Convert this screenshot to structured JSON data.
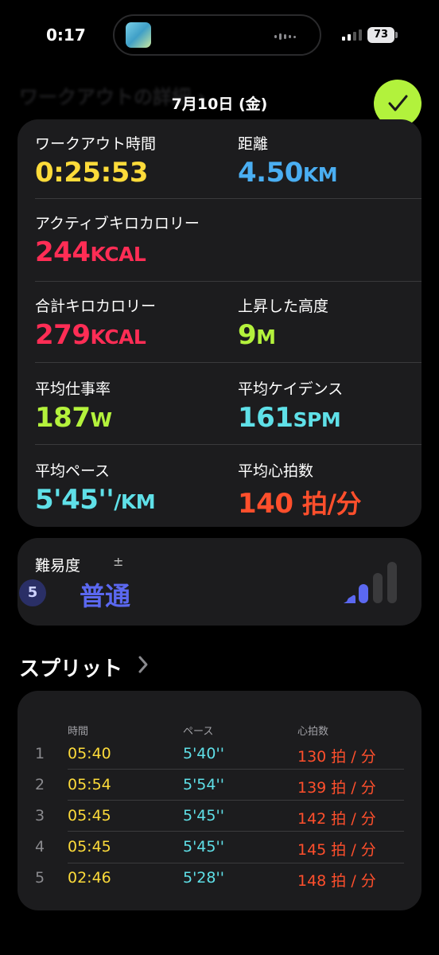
{
  "status_bar": {
    "time": "0:17",
    "battery": "73"
  },
  "header": {
    "ghost_title": "ワークアウトの詳細 ›",
    "date": "7月10日 (金)"
  },
  "stats": {
    "workout_time": {
      "label": "ワークアウト時間",
      "value": "0:25:53"
    },
    "distance": {
      "label": "距離",
      "value": "4.50",
      "unit": "KM"
    },
    "active_kcal": {
      "label": "アクティブキロカロリー",
      "value": "244",
      "unit": "KCAL"
    },
    "total_kcal": {
      "label": "合計キロカロリー",
      "value": "279",
      "unit": "KCAL"
    },
    "elevation": {
      "label": "上昇した高度",
      "value": "9",
      "unit": "M"
    },
    "avg_power": {
      "label": "平均仕事率",
      "value": "187",
      "unit": "W"
    },
    "avg_cadence": {
      "label": "平均ケイデンス",
      "value": "161",
      "unit": "SPM"
    },
    "avg_pace": {
      "label": "平均ペース",
      "value": "5'45''",
      "unit": "/KM"
    },
    "avg_hr": {
      "label": "平均心拍数",
      "value": "140",
      "unit": "拍/分"
    }
  },
  "difficulty": {
    "label": "難易度",
    "pm": "±",
    "level": "5",
    "text": "普通",
    "bars_filled": 2,
    "bars_total": 4
  },
  "splits": {
    "title": "スプリット",
    "headers": {
      "time": "時間",
      "pace": "ペース",
      "hr": "心拍数"
    },
    "rows": [
      {
        "idx": "1",
        "time": "05:40",
        "pace": "5'40''",
        "hr": "130 拍 / 分"
      },
      {
        "idx": "2",
        "time": "05:54",
        "pace": "5'54''",
        "hr": "139 拍 / 分"
      },
      {
        "idx": "3",
        "time": "05:45",
        "pace": "5'45''",
        "hr": "142 拍 / 分"
      },
      {
        "idx": "4",
        "time": "05:45",
        "pace": "5'45''",
        "hr": "145 拍 / 分"
      },
      {
        "idx": "5",
        "time": "02:46",
        "pace": "5'28''",
        "hr": "148 拍 / 分"
      }
    ]
  },
  "colors": {
    "time": "#fddb3a",
    "distance": "#4aaef2",
    "calories": "#ff2d55",
    "elevation_power": "#b4f23c",
    "cadence_pace": "#5fe0e8",
    "heart_rate": "#ff4f2c",
    "difficulty": "#5b68f0",
    "done_button": "#b2f23c"
  },
  "icons": {
    "done": "checkmark-icon",
    "splits_more": "chevron-right-icon",
    "difficulty": "effort-bars-icon"
  }
}
